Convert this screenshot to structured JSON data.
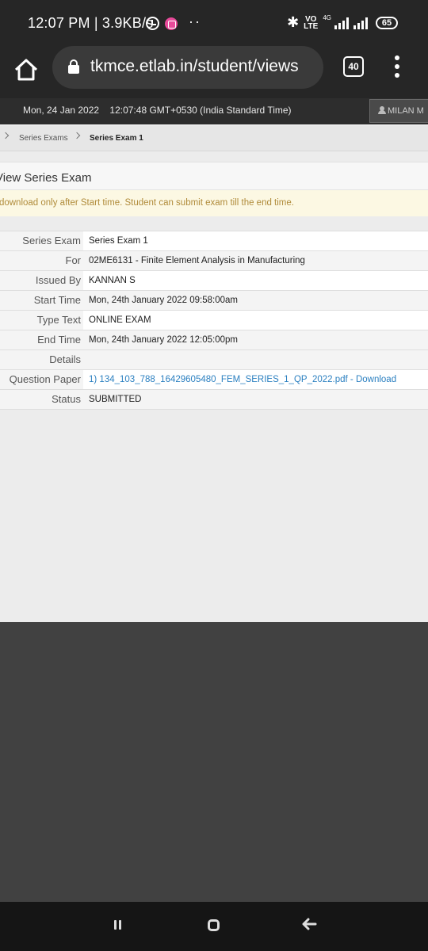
{
  "status_bar": {
    "time_speed": "12:07 PM | 3.9KB/s",
    "dots": "··",
    "network_tag": "VO\nLTE",
    "net_gen": "4G",
    "battery": "65"
  },
  "browser": {
    "url": "tkmce.etlab.in/student/views",
    "tab_count": "40"
  },
  "topbar": {
    "datetime": "Mon, 24 Jan 2022    12:07:48 GMT+0530 (India Standard Time)",
    "user": "MILAN M"
  },
  "breadcrumb": {
    "items": [
      "Series Exams",
      "Series Exam 1"
    ]
  },
  "panel": {
    "title": "View Series Exam",
    "notice": "Question can download only after Start time. Student can submit exam till the end time."
  },
  "details": [
    {
      "label": "Series Exam",
      "value": "Series Exam 1"
    },
    {
      "label": "For",
      "value": "02ME6131 - Finite Element Analysis in Manufacturing"
    },
    {
      "label": "Issued By",
      "value": "KANNAN S"
    },
    {
      "label": "Start Time",
      "value": "Mon, 24th January 2022 09:58:00am"
    },
    {
      "label": "Type Text",
      "value": "ONLINE EXAM"
    },
    {
      "label": "End Time",
      "value": "Mon, 24th January 2022 12:05:00pm"
    },
    {
      "label": "Details",
      "value": ""
    },
    {
      "label": "Question Paper",
      "value": "1) 134_103_788_16429605480_FEM_SERIES_1_QP_2022.pdf - Download"
    },
    {
      "label": "Status",
      "value": "SUBMITTED"
    }
  ],
  "colors": {
    "link": "#2a7fc0",
    "notice_bg": "#fcf8e3",
    "notice_text": "#b08b3a",
    "topbar": "#2d2d2d"
  },
  "icons": [
    "clock-icon",
    "app-notification-icon",
    "bluetooth-icon",
    "signal-icon",
    "battery-icon",
    "home-icon",
    "lock-icon",
    "tabs-icon",
    "more-vert-icon",
    "user-icon",
    "chevron-right-icon",
    "recents-icon",
    "home-nav-icon",
    "back-icon"
  ]
}
